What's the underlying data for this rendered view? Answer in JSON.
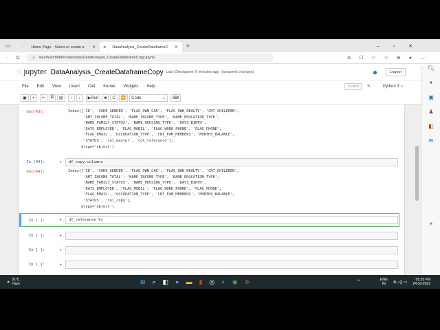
{
  "browser": {
    "tabs": [
      {
        "title": "Home Page - Select or create a"
      },
      {
        "title": "DataAnalysis_CreateDataframeC"
      }
    ],
    "url": "localhost:8888/notebooks/DataAnalysis_CreateDataframeCopy.ipynb"
  },
  "jupyter": {
    "logo": "jupyter",
    "title": "DataAnalysis_CreateDataframeCopy",
    "checkpoint": "Last Checkpoint: 6 minutes ago",
    "unsaved": "(unsaved changes)",
    "logout": "Logout",
    "trusted": "Trusted",
    "kernel": "Python 3"
  },
  "menu": [
    "File",
    "Edit",
    "View",
    "Insert",
    "Cell",
    "Kernel",
    "Widgets",
    "Help"
  ],
  "toolbar": {
    "run": "Run",
    "cell_type": "Code"
  },
  "cells": {
    "out43": {
      "prompt": "Out[43]:",
      "text": "Index(['ID', 'CODE_GENDER', 'FLAG_OWN_CAR', 'FLAG_OWN_REALTY', 'CNT_CHILDREN',\n       'AMT_INCOME_TOTAL', 'NAME_INCOME_TYPE', 'NAME_EDUCATION_TYPE',\n       'NAME_FAMILY_STATUS', 'NAME_HOUSING_TYPE', 'DAYS_BIRTH',\n       'DAYS_EMPLOYED', 'FLAG_MOBIL', 'FLAG_WORK_PHONE', 'FLAG_PHONE',\n       'FLAG_EMAIL', 'OCCUPATION_TYPE', 'CNT_FAM_MEMBERS', 'MONTHS_BALANCE',\n       'STATUS', 'col_master', 'col_reference'],\n      dtype='object')"
    },
    "in44": {
      "prompt": "In [44]:",
      "code": "df_copy.columns"
    },
    "out44": {
      "prompt": "Out[44]:",
      "text": "Index(['ID', 'CODE_GENDER', 'FLAG_OWN_CAR', 'FLAG_OWN_REALTY', 'CNT_CHILDREN',\n       'AMT_INCOME_TOTAL', 'NAME_INCOME_TYPE', 'NAME_EDUCATION_TYPE',\n       'NAME_FAMILY_STATUS', 'NAME_HOUSING_TYPE', 'DAYS_BIRTH',\n       'DAYS_EMPLOYED', 'FLAG_MOBIL', 'FLAG_WORK_PHONE', 'FLAG_PHONE',\n       'FLAG_EMAIL', 'OCCUPATION_TYPE', 'CNT_FAM_MEMBERS', 'MONTHS_BALANCE',\n       'STATUS', 'col_copy'],\n      dtype='object')"
    },
    "active": {
      "prompt": "In [ ]:",
      "code": "df_reference %s"
    },
    "empty_prompt": "In [ ]:"
  },
  "taskbar": {
    "temp": "31°C",
    "weather": "Haze",
    "lang1": "ENG",
    "lang2": "IN",
    "time": "05:25 PM",
    "date": "24-10-2022"
  }
}
